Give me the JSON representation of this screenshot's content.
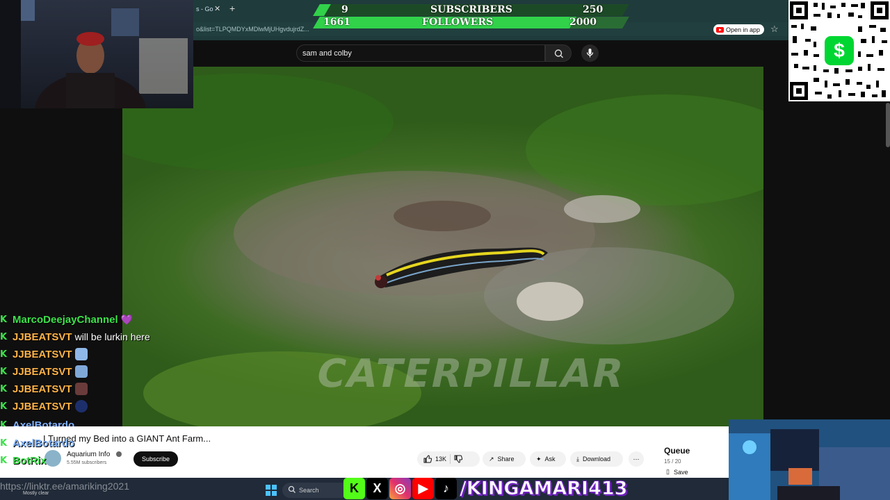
{
  "browser": {
    "tab_title": "s - Go",
    "address": "o&list=TLPQMDYxMDlwMjUHgvdujrdZ...",
    "open_in_app": "Open in app"
  },
  "goals": {
    "subscribers": {
      "label": "SUBSCRIBERS",
      "current": "9",
      "target": "250",
      "progress": 0.036
    },
    "followers": {
      "label": "FOLLOWERS",
      "current": "1661",
      "target": "2000",
      "progress": 0.83
    }
  },
  "youtube": {
    "search_query": "sam and colby",
    "video_watermark": "CATERPILLAR",
    "video_title": "I Turned my Bed into a GIANT Ant Farm...",
    "channel_name": "Aquarium Info",
    "channel_subs": "5.55M subscribers",
    "subscribe_label": "Subscribe",
    "likes": "13K",
    "share_label": "Share",
    "ask_label": "Ask",
    "download_label": "Download",
    "queue_title": "Queue",
    "queue_count": "15 / 20",
    "save_label": "Save"
  },
  "chat": [
    {
      "user": "MarcoDeejayChannel",
      "message": "",
      "user_color": "#3ee14c"
    },
    {
      "user": "JJBEATSVT",
      "message": "will be lurkin here"
    },
    {
      "user": "JJBEATSVT",
      "message": ""
    },
    {
      "user": "JJBEATSVT",
      "message": ""
    },
    {
      "user": "JJBEATSVT",
      "message": ""
    },
    {
      "user": "JJBEATSVT",
      "message": ""
    },
    {
      "user": "AxelBotardo",
      "message": ""
    },
    {
      "user": "AxelBotardo",
      "message": ""
    },
    {
      "user": "BotRix",
      "message": ""
    }
  ],
  "taskbar": {
    "link": "https://linktr.ee/amariking2021",
    "weather": "Mostly clear",
    "search_label": "Search"
  },
  "socials": {
    "handle": "/KINGAMARI413",
    "icons": [
      "kick-logo",
      "x-logo",
      "instagram-logo",
      "youtube-logo",
      "tiktok-logo"
    ]
  }
}
